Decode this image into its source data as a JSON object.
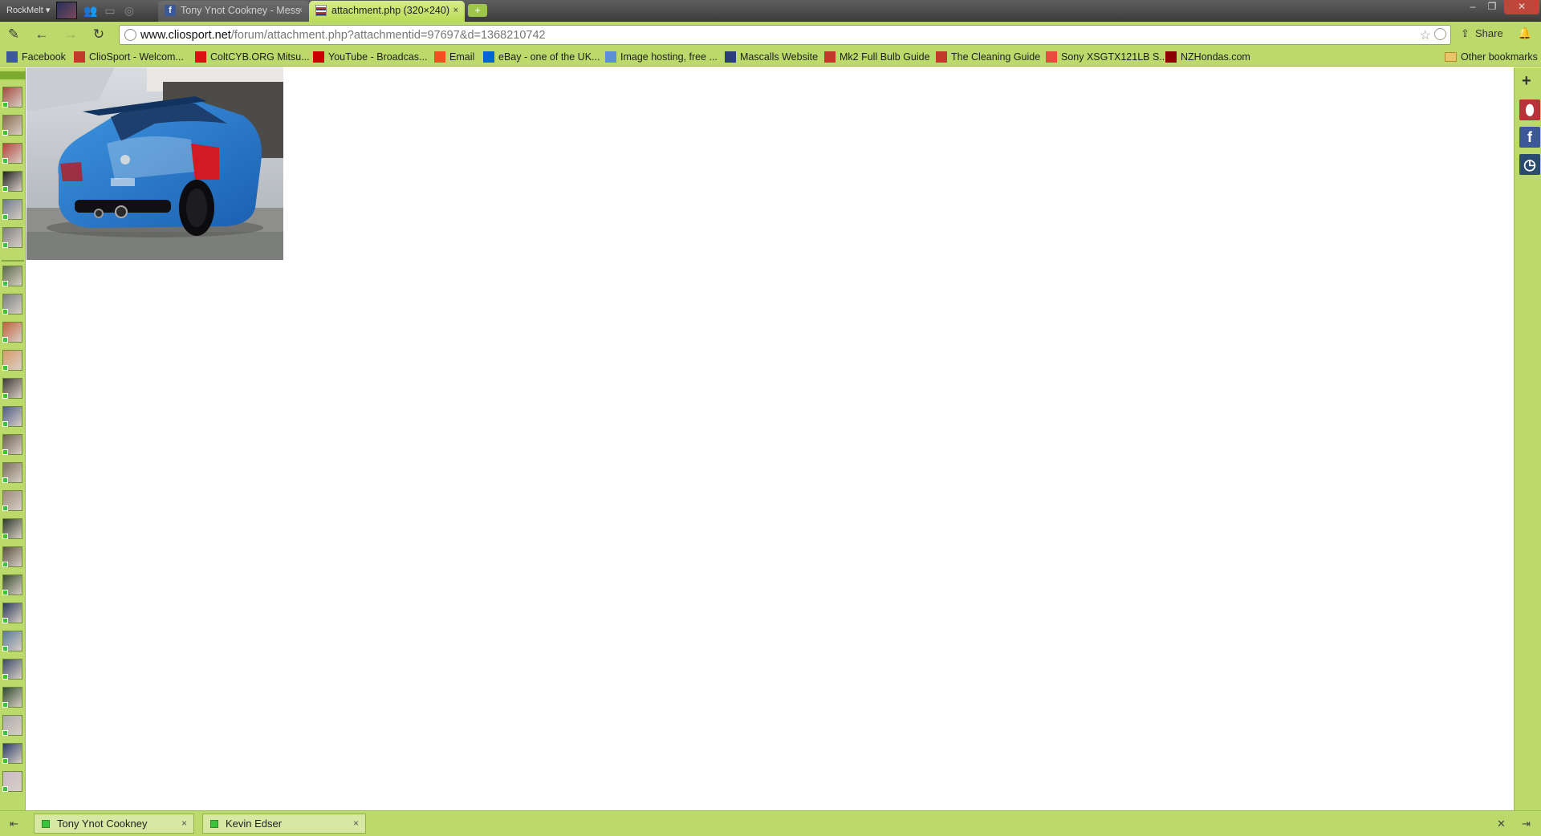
{
  "rockmelt": {
    "menu_label": "RockMelt ▾"
  },
  "tabs": [
    {
      "title": "Tony Ynot Cookney - Mess",
      "close": "×"
    },
    {
      "title": "attachment.php (320×240)",
      "close": "×"
    }
  ],
  "new_tab_label": "+",
  "window_buttons": {
    "minimize": "–",
    "restore": "❐",
    "close": "✕"
  },
  "toolbar": {
    "url_host": "www.cliosport.net",
    "url_path": "/forum/attachment.php?attachmentid=97697&d=1368210742",
    "share_label": "Share"
  },
  "bookmarks": [
    {
      "label": "Facebook",
      "color": "#3b5998"
    },
    {
      "label": "ClioSport - Welcom...",
      "color": "#c0392b"
    },
    {
      "label": "ColtCYB.ORG Mitsu...",
      "color": "#d11"
    },
    {
      "label": "YouTube - Broadcas...",
      "color": "#cc0000"
    },
    {
      "label": "Email",
      "color": "#f25022"
    },
    {
      "label": "eBay - one of the UK...",
      "color": "#0064d2"
    },
    {
      "label": "Image hosting, free ...",
      "color": "#5b8fd6"
    },
    {
      "label": "Mascalls Website",
      "color": "#2c3e7a"
    },
    {
      "label": "Mk2 Full Bulb Guide",
      "color": "#c0392b"
    },
    {
      "label": "The Cleaning Guide",
      "color": "#c0392b"
    },
    {
      "label": "Sony XSGTX121LB S...",
      "color": "#e74c3c"
    },
    {
      "label": "NZHondas.com",
      "color": "#8b0000"
    }
  ],
  "other_bookmarks_label": "Other bookmarks",
  "friends_count_top": 6,
  "friends_count_bottom": 20,
  "right_apps": [
    {
      "name": "rockmelt-app",
      "color": "#b8323a",
      "glyph": "⬮"
    },
    {
      "name": "facebook-app",
      "color": "#3b5998",
      "glyph": "f"
    },
    {
      "name": "history-app",
      "color": "#2b4a6f",
      "glyph": "◷"
    }
  ],
  "content": {
    "image_alt": "Blue Renault Clio RS hatchback rear view"
  },
  "chats": [
    {
      "name": "Tony Ynot Cookney",
      "close": "×"
    },
    {
      "name": "Kevin Edser",
      "close": "×"
    }
  ]
}
